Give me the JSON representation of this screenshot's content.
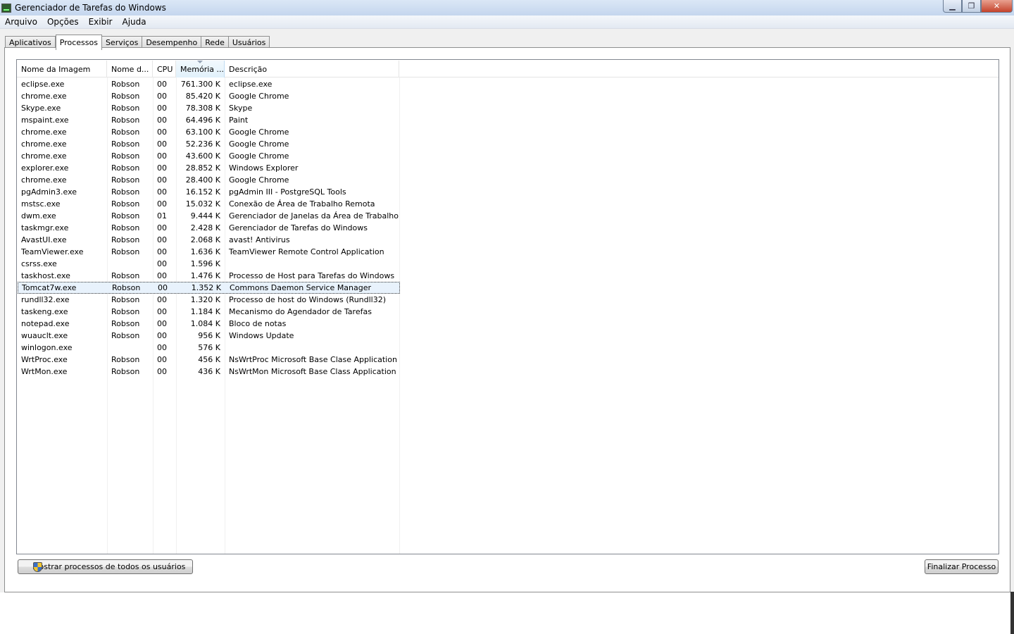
{
  "window": {
    "title": "Gerenciador de Tarefas do Windows"
  },
  "menu": [
    "Arquivo",
    "Opções",
    "Exibir",
    "Ajuda"
  ],
  "tabs": [
    "Aplicativos",
    "Processos",
    "Serviços",
    "Desempenho",
    "Rede",
    "Usuários"
  ],
  "active_tab": "Processos",
  "columns": [
    "Nome da Imagem",
    "Nome d...",
    "CPU",
    "Memória ...",
    "Descrição"
  ],
  "sorted_column": "Memória ...",
  "selected_row": 17,
  "rows": [
    [
      "eclipse.exe",
      "Robson",
      "00",
      "761.300 K",
      "eclipse.exe"
    ],
    [
      "chrome.exe",
      "Robson",
      "00",
      "85.420 K",
      "Google Chrome"
    ],
    [
      "Skype.exe",
      "Robson",
      "00",
      "78.308 K",
      "Skype"
    ],
    [
      "mspaint.exe",
      "Robson",
      "00",
      "64.496 K",
      "Paint"
    ],
    [
      "chrome.exe",
      "Robson",
      "00",
      "63.100 K",
      "Google Chrome"
    ],
    [
      "chrome.exe",
      "Robson",
      "00",
      "52.236 K",
      "Google Chrome"
    ],
    [
      "chrome.exe",
      "Robson",
      "00",
      "43.600 K",
      "Google Chrome"
    ],
    [
      "explorer.exe",
      "Robson",
      "00",
      "28.852 K",
      "Windows Explorer"
    ],
    [
      "chrome.exe",
      "Robson",
      "00",
      "28.400 K",
      "Google Chrome"
    ],
    [
      "pgAdmin3.exe",
      "Robson",
      "00",
      "16.152 K",
      "pgAdmin III - PostgreSQL Tools"
    ],
    [
      "mstsc.exe",
      "Robson",
      "00",
      "15.032 K",
      "Conexão de Área de Trabalho Remota"
    ],
    [
      "dwm.exe",
      "Robson",
      "01",
      "9.444 K",
      "Gerenciador de Janelas da Área de Trabalho"
    ],
    [
      "taskmgr.exe",
      "Robson",
      "00",
      "2.428 K",
      "Gerenciador de Tarefas do Windows"
    ],
    [
      "AvastUI.exe",
      "Robson",
      "00",
      "2.068 K",
      "avast! Antivirus"
    ],
    [
      "TeamViewer.exe",
      "Robson",
      "00",
      "1.636 K",
      "TeamViewer Remote Control Application"
    ],
    [
      "csrss.exe",
      "",
      "00",
      "1.596 K",
      ""
    ],
    [
      "taskhost.exe",
      "Robson",
      "00",
      "1.476 K",
      "Processo de Host para Tarefas do Windows"
    ],
    [
      "Tomcat7w.exe",
      "Robson",
      "00",
      "1.352 K",
      "Commons Daemon Service Manager"
    ],
    [
      "rundll32.exe",
      "Robson",
      "00",
      "1.320 K",
      "Processo de host do Windows (Rundll32)"
    ],
    [
      "taskeng.exe",
      "Robson",
      "00",
      "1.184 K",
      "Mecanismo do Agendador de Tarefas"
    ],
    [
      "notepad.exe",
      "Robson",
      "00",
      "1.084 K",
      "Bloco de notas"
    ],
    [
      "wuauclt.exe",
      "Robson",
      "00",
      "956 K",
      "Windows Update"
    ],
    [
      "winlogon.exe",
      "",
      "00",
      "576 K",
      ""
    ],
    [
      "WrtProc.exe",
      "Robson",
      "00",
      "456 K",
      "NsWrtProc Microsoft Base Clase Application"
    ],
    [
      "WrtMon.exe",
      "Robson",
      "00",
      "436 K",
      "NsWrtMon Microsoft Base Class Application"
    ]
  ],
  "buttons": {
    "show_all": "Mostrar processos de todos os usuários",
    "end_process": "Finalizar Processo"
  }
}
